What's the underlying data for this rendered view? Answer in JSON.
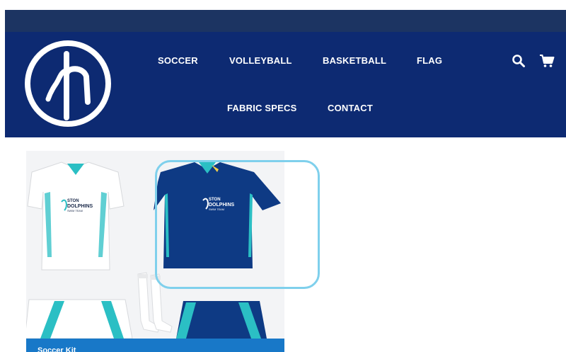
{
  "header": {
    "nav": [
      {
        "label": "SOCCER"
      },
      {
        "label": "VOLLEYBALL"
      },
      {
        "label": "BASKETBALL"
      },
      {
        "label": "FLAG"
      },
      {
        "label": "FABRIC SPECS"
      },
      {
        "label": "CONTACT"
      }
    ],
    "icons": [
      "search-icon",
      "cart-icon"
    ]
  },
  "product": {
    "caption": "Soccer Kit",
    "jersey_logo_text": [
      "STON",
      "DOLPHINS",
      "SWIM TEAM"
    ]
  },
  "colors": {
    "topbar": "#1c3462",
    "header": "#0d2a72",
    "accent": "#1878c8",
    "highlight": "#7fd0ec",
    "teal": "#2bbfc4"
  }
}
